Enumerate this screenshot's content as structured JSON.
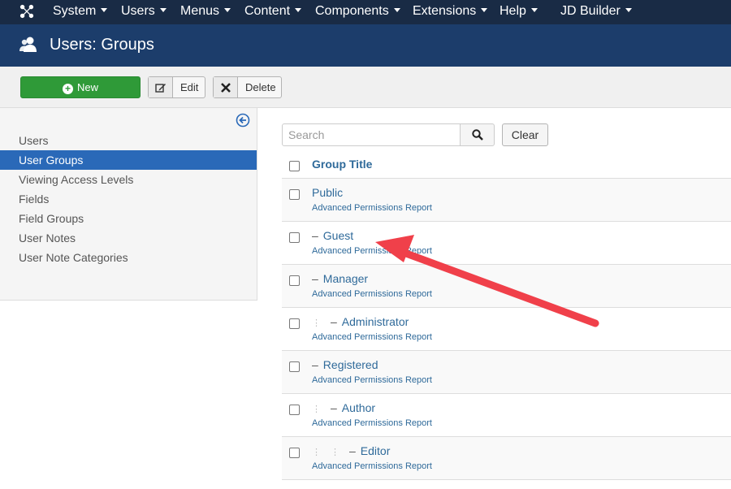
{
  "topnav": {
    "items": [
      {
        "label": "System"
      },
      {
        "label": "Users"
      },
      {
        "label": "Menus"
      },
      {
        "label": "Content"
      },
      {
        "label": "Components"
      },
      {
        "label": "Extensions"
      },
      {
        "label": "Help"
      },
      {
        "label": "JD Builder"
      }
    ],
    "background": "#192b45"
  },
  "header": {
    "title": "Users: Groups",
    "background": "#1c3d6b",
    "icon": "users-icon"
  },
  "toolbar": {
    "new_label": "New",
    "edit_label": "Edit",
    "delete_label": "Delete",
    "new_color": "#2f9a38"
  },
  "sidebar": {
    "items": [
      {
        "label": "Users",
        "active": false
      },
      {
        "label": "User Groups",
        "active": true
      },
      {
        "label": "Viewing Access Levels",
        "active": false
      },
      {
        "label": "Fields",
        "active": false
      },
      {
        "label": "Field Groups",
        "active": false
      },
      {
        "label": "User Notes",
        "active": false
      },
      {
        "label": "User Note Categories",
        "active": false
      }
    ],
    "active_color": "#2a69b8"
  },
  "search": {
    "placeholder": "Search",
    "value": "",
    "clear_label": "Clear"
  },
  "table": {
    "header": "Group Title",
    "perm_label": "Advanced Permissions Report",
    "rows": [
      {
        "title": "Public",
        "level": 0
      },
      {
        "title": "Guest",
        "level": 1
      },
      {
        "title": "Manager",
        "level": 1
      },
      {
        "title": "Administrator",
        "level": 2
      },
      {
        "title": "Registered",
        "level": 1
      },
      {
        "title": "Author",
        "level": 2
      },
      {
        "title": "Editor",
        "level": 3
      }
    ]
  },
  "annotation": {
    "arrow_color": "#f0404a",
    "icon": "arrow-icon"
  }
}
